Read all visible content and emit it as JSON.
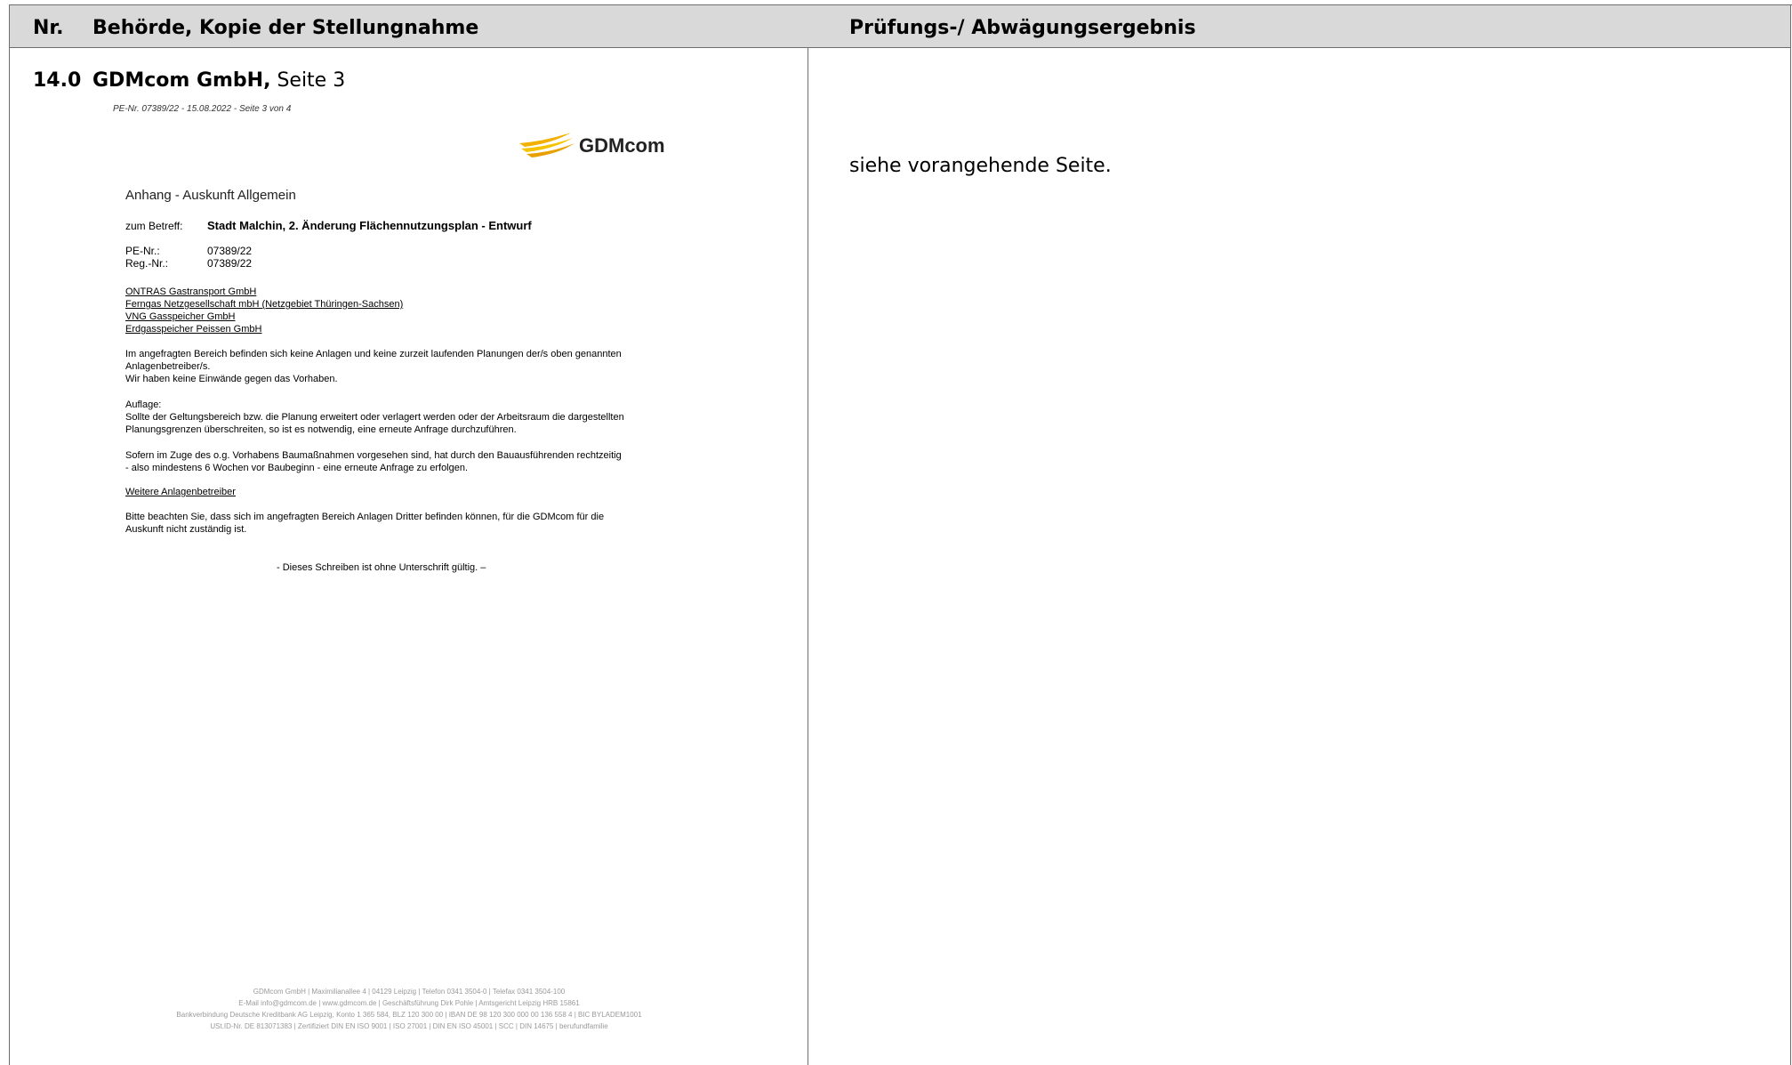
{
  "header": {
    "nr": "Nr.",
    "behoerde": "Behörde, Kopie der Stellungnahme",
    "pruefung": "Prüfungs-/ Abwägungsergebnis"
  },
  "entry": {
    "nr": "14.0",
    "company": "GDMcom GmbH,",
    "page": " Seite 3"
  },
  "right_text": "siehe vorangehende Seite.",
  "letter": {
    "pe_line": "PE-Nr. 07389/22 - 15.08.2022 - Seite 3 von 4",
    "logo_text": "GDMcom",
    "anhang": "Anhang - Auskunft Allgemein",
    "betreff_label": "zum Betreff:",
    "betreff_value": "Stadt Malchin, 2. Änderung Flächennutzungsplan - Entwurf",
    "pe_label": "PE-Nr.:",
    "pe_value": "07389/22",
    "reg_label": "Reg.-Nr.:",
    "reg_value": "07389/22",
    "companies": [
      "ONTRAS Gastransport GmbH",
      "Ferngas Netzgesellschaft mbH (Netzgebiet Thüringen-Sachsen)",
      "VNG Gasspeicher GmbH",
      "Erdgasspeicher Peissen GmbH"
    ],
    "p1_l1": "Im angefragten Bereich befinden sich keine Anlagen und keine zurzeit laufenden Planungen der/s oben genannten",
    "p1_l2": "Anlagenbetreiber/s.",
    "p1_l3": "Wir haben keine Einwände gegen das Vorhaben.",
    "p2_l1": "Auflage:",
    "p2_l2": "Sollte der Geltungsbereich bzw. die Planung erweitert oder verlagert werden oder der Arbeitsraum die dargestellten",
    "p2_l3": "Planungsgrenzen überschreiten, so ist es notwendig, eine erneute Anfrage durchzuführen.",
    "p3_l1": "Sofern im Zuge des o.g. Vorhabens Baumaßnahmen vorgesehen sind, hat durch den Bauausführenden rechtzeitig",
    "p3_l2": "- also mindestens 6 Wochen vor Baubeginn - eine erneute Anfrage zu erfolgen.",
    "weitere": "Weitere Anlagenbetreiber",
    "p5_l1": "Bitte beachten Sie, dass sich im angefragten Bereich Anlagen Dritter befinden können, für die GDMcom für die",
    "p5_l2": "Auskunft nicht zuständig ist.",
    "signature": "- Dieses Schreiben ist ohne Unterschrift gültig. –",
    "footer_l1": "GDMcom GmbH | Maximilianallee 4 | 04129 Leipzig | Telefon 0341 3504-0 | Telefax 0341 3504-100",
    "footer_l2": "E-Mail info@gdmcom.de | www.gdmcom.de | Geschäftsführung Dirk Pohle | Amtsgericht Leipzig HRB 15861",
    "footer_l3": "Bankverbindung Deutsche Kreditbank AG Leipzig, Konto 1 365 584, BLZ 120 300 00 | IBAN DE 98 120 300 000 00 136 558 4 | BIC BYLADEM1001",
    "footer_l4": "USt.ID-Nr. DE 813071383 | Zertifiziert DIN EN ISO 9001 | ISO 27001 | DIN EN ISO 45001 | SCC | DIN 14675 | berufundfamilie"
  },
  "colors": {
    "header_bg": "#d9d9d9",
    "border": "#6e6e6e",
    "logo_yellow": "#f2b000"
  }
}
